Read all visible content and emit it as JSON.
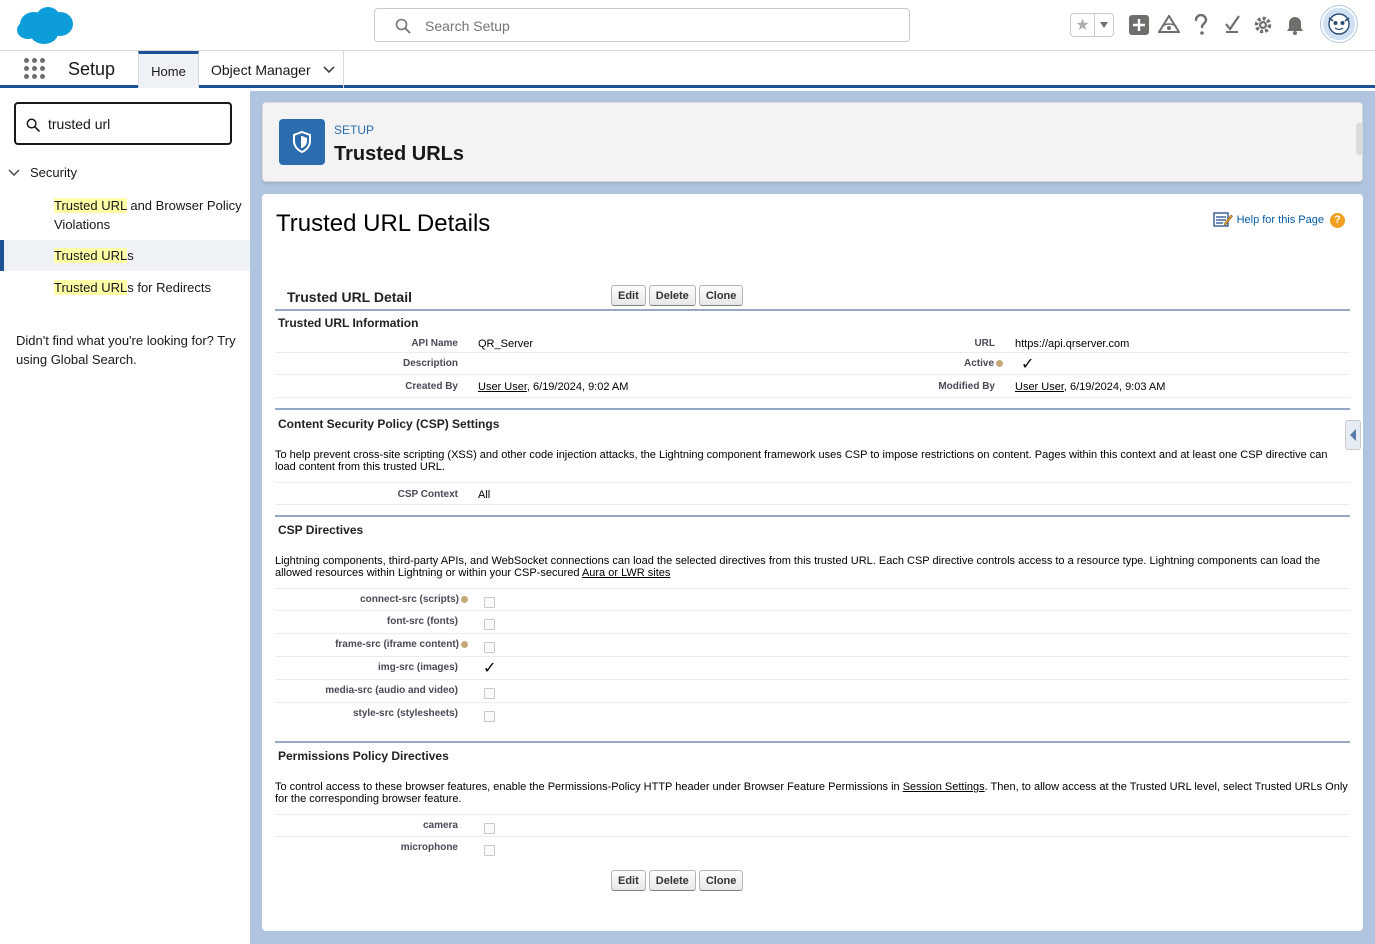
{
  "header": {
    "search_placeholder": "Search Setup"
  },
  "context_bar": {
    "app_name": "Setup",
    "tabs": [
      {
        "label": "Home"
      },
      {
        "label": "Object Manager"
      }
    ]
  },
  "sidebar": {
    "quickfind_value": "trusted url",
    "tree_root": "Security",
    "items": [
      {
        "highlight": "Trusted URL",
        "rest": " and Browser Policy Violations"
      },
      {
        "highlight": "Trusted URL",
        "rest": "s"
      },
      {
        "highlight": "Trusted URL",
        "rest": "s for Redirects"
      }
    ],
    "not_found_text": "Didn't find what you're looking for? Try using Global Search."
  },
  "page_header": {
    "eyebrow": "SETUP",
    "title": "Trusted URLs"
  },
  "detail": {
    "title": "Trusted URL Details",
    "help_link": "Help for this Page",
    "help_q": "?",
    "block_title": "Trusted URL Detail",
    "buttons": {
      "edit": "Edit",
      "delete": "Delete",
      "clone": "Clone"
    },
    "info_section": {
      "title": "Trusted URL Information",
      "api_name_label": "API Name",
      "api_name_value": "QR_Server",
      "url_label": "URL",
      "url_value": "https://api.qrserver.com",
      "description_label": "Description",
      "active_label": "Active",
      "created_by_label": "Created By",
      "created_by_user": "User User",
      "created_by_date": ", 6/19/2024, 9:02 AM",
      "modified_by_label": "Modified By",
      "modified_by_user": "User User",
      "modified_by_date": ", 6/19/2024, 9:03 AM"
    },
    "csp_section": {
      "title": "Content Security Policy (CSP) Settings",
      "description": "To help prevent cross-site scripting (XSS) and other code injection attacks, the Lightning component framework uses CSP to impose restrictions on content. Pages within this context and at least one CSP directive can load content from this trusted URL.",
      "context_label": "CSP Context",
      "context_value": "All"
    },
    "directives_section": {
      "title": "CSP Directives",
      "description_prefix": "Lightning components, third-party APIs, and WebSocket connections can load the selected directives from this trusted URL. Each CSP directive controls access to a resource type. Lightning components can load the allowed resources within Lightning or within your CSP-secured ",
      "description_link": "Aura or LWR sites",
      "directives": [
        {
          "label": "connect-src (scripts)",
          "checked": false,
          "info": true
        },
        {
          "label": "font-src (fonts)",
          "checked": false,
          "info": false
        },
        {
          "label": "frame-src (iframe content)",
          "checked": false,
          "info": true
        },
        {
          "label": "img-src (images)",
          "checked": true,
          "info": false
        },
        {
          "label": "media-src (audio and video)",
          "checked": false,
          "info": false
        },
        {
          "label": "style-src (stylesheets)",
          "checked": false,
          "info": false
        }
      ]
    },
    "permissions_section": {
      "title": "Permissions Policy Directives",
      "description_prefix": "To control access to these browser features, enable the Permissions-Policy HTTP header under Browser Feature Permissions in ",
      "description_link": "Session Settings",
      "description_suffix": ". Then, to allow access at the Trusted URL level, select Trusted URLs Only for the corresponding browser feature.",
      "features": [
        {
          "label": "camera",
          "checked": false
        },
        {
          "label": "microphone",
          "checked": false
        }
      ]
    }
  },
  "colors": {
    "brand": "#1b5297",
    "page_icon": "#2a6cae",
    "highlight": "#ffffa8",
    "main_bg": "#b0c4df"
  }
}
